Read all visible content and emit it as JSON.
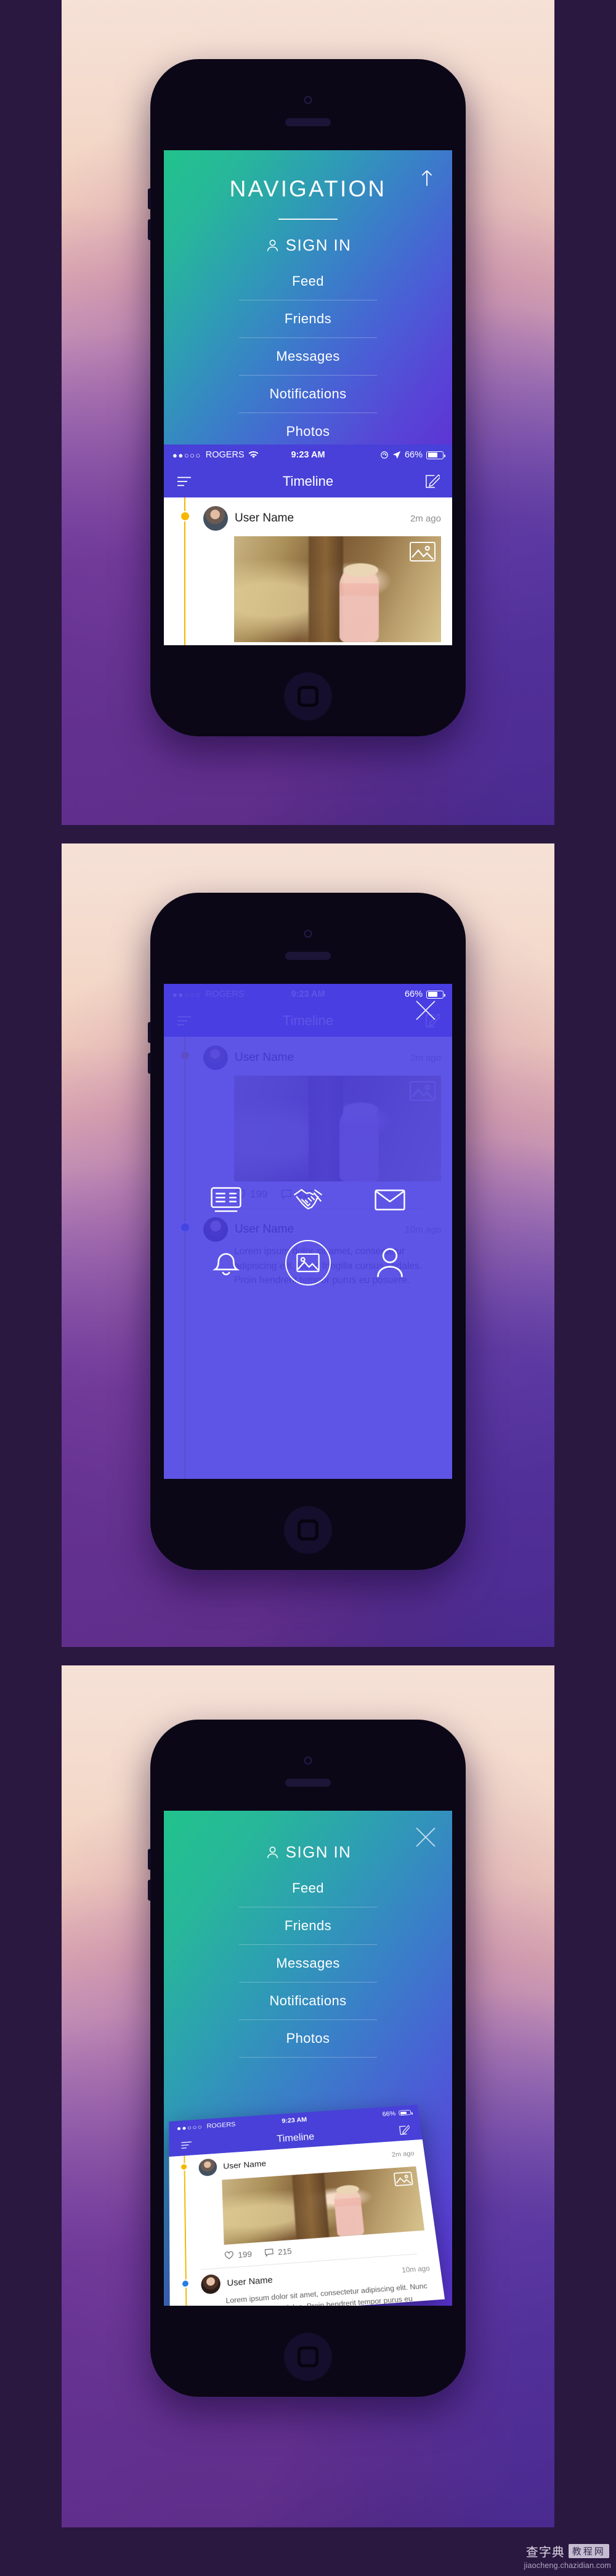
{
  "nav": {
    "title": "NAVIGATION",
    "sign_in": "SIGN IN",
    "items": [
      {
        "label": "Feed",
        "icon": "feed-icon"
      },
      {
        "label": "Friends",
        "icon": "handshake-icon"
      },
      {
        "label": "Messages",
        "icon": "envelope-icon"
      },
      {
        "label": "Notifications",
        "icon": "bell-icon"
      },
      {
        "label": "Photos",
        "icon": "photo-icon"
      }
    ],
    "profile_icon": "person-icon",
    "arrow_up_icon": "arrow-up-icon",
    "close_icon": "close-icon"
  },
  "icon_menu": {
    "cells": [
      {
        "name": "feed-icon",
        "label": "Feed"
      },
      {
        "name": "handshake-icon",
        "label": "Friends"
      },
      {
        "name": "envelope-icon",
        "label": "Messages"
      },
      {
        "name": "bell-icon",
        "label": "Notifications"
      },
      {
        "name": "photo-icon",
        "label": "Photos"
      },
      {
        "name": "person-icon",
        "label": "Profile"
      }
    ],
    "selected": "photo-icon"
  },
  "status_bar": {
    "signal_dots": "●●○○○",
    "carrier": "ROGERS",
    "wifi_icon": "wifi-icon",
    "time": "9:23 AM",
    "lock_icon": "rotation-lock-icon",
    "location_icon": "location-arrow-icon",
    "battery_percent": "66%"
  },
  "navbar": {
    "menu_icon": "hamburger-icon",
    "title": "Timeline",
    "compose_icon": "compose-icon"
  },
  "feed": {
    "posts": [
      {
        "name": "User Name",
        "time": "2m ago",
        "avatar": "avatar-male",
        "photo_badge_icon": "image-icon",
        "likes": "199",
        "comments": "215",
        "like_icon": "heart-icon",
        "comment_icon": "comment-icon"
      },
      {
        "name": "User Name",
        "time": "10m ago",
        "avatar": "avatar-female",
        "text": "Lorem ipsum dolor sit amet, consectetur adipiscing elit. Nunc fringilla cursus sodales. Proin hendrerit tempor purus eu posuere."
      }
    ]
  },
  "watermark": {
    "cn": "查字典",
    "box": "教程网",
    "url": "jiaocheng.chazidian.com"
  },
  "colors": {
    "gradient_start": "#21c38c",
    "gradient_end": "#5c35d4",
    "ios_blue": "#4840d8",
    "rail_yellow": "#f0b800",
    "dot_blue": "#2a7de1"
  }
}
